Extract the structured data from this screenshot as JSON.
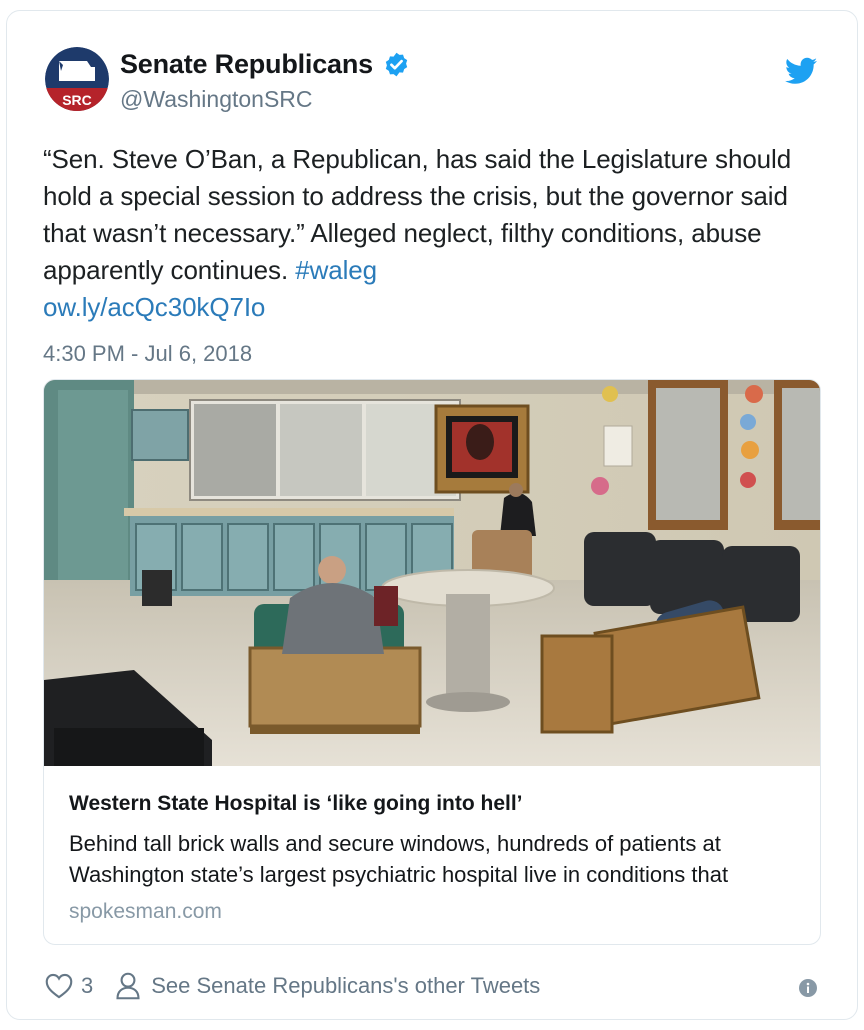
{
  "author": {
    "display_name": "Senate Republicans",
    "handle": "@WashingtonSRC",
    "avatar_text": "SRC",
    "verified": true
  },
  "tweet": {
    "text_parts": [
      "“Sen. Steve O’Ban, a Republican, has said the Legislature should hold a special session to address the crisis, but the governor said that wasn’t necessary.” Alleged neglect, filthy conditions, abuse apparently continues. ",
      "#waleg",
      "ow.ly/acQc30kQ7Io"
    ],
    "timestamp": "4:30 PM - Jul 6, 2018"
  },
  "card": {
    "title": "Western State Hospital is ‘like going into hell’",
    "description": "Behind tall brick walls and secure windows, hundreds of patients at Washington state’s largest psychiatric hospital live in conditions that",
    "domain": "spokesman.com"
  },
  "actions": {
    "like_count": "3",
    "other_tweets_label": "See Senate Republicans's other Tweets"
  },
  "icons": {
    "verified": "verified-badge-icon",
    "bird": "twitter-bird-icon",
    "like": "heart-icon",
    "profile": "person-icon",
    "info": "info-icon"
  },
  "colors": {
    "link": "#2b7bb9",
    "verified": "#1da1f2",
    "muted": "#657786",
    "avatar_navy": "#1e3a6b",
    "avatar_red": "#b5232a"
  }
}
